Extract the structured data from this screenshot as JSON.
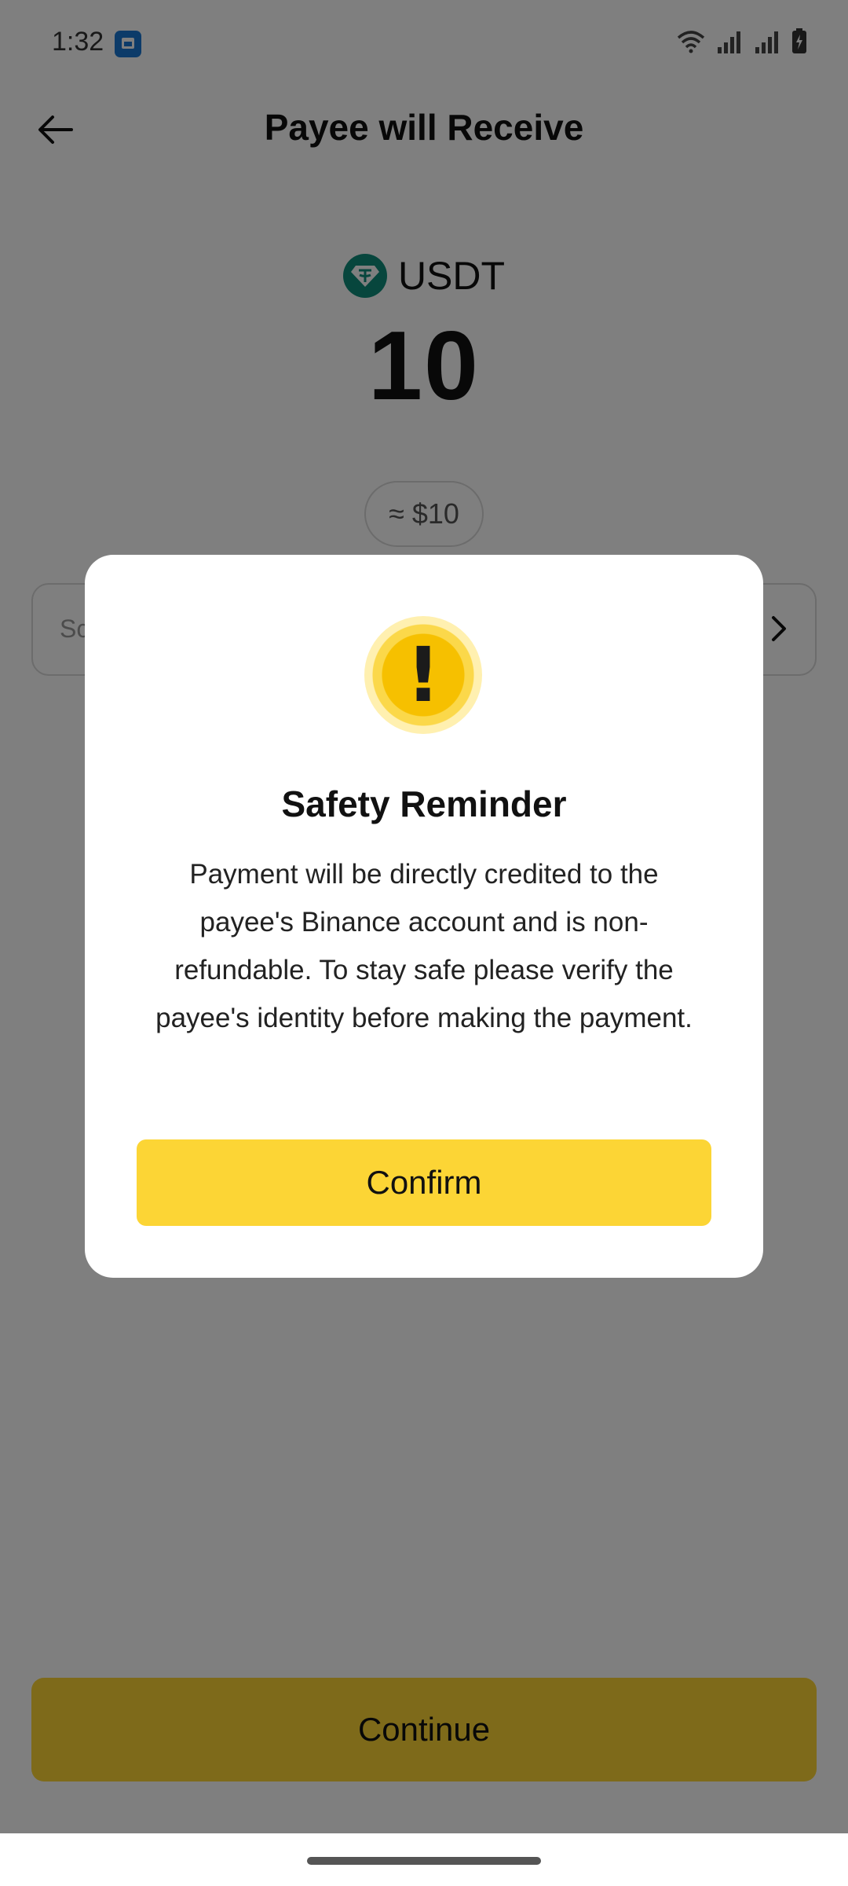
{
  "status_bar": {
    "time": "1:32",
    "icons": [
      "wifi-icon",
      "signal-icon",
      "signal-icon",
      "battery-charging-icon"
    ]
  },
  "header": {
    "title": "Payee will Receive",
    "back_icon": "arrow-left-icon"
  },
  "amount": {
    "currency": "USDT",
    "value": "10",
    "fiat_equivalent": "≈ $10",
    "coin_color": "#0e8c7a"
  },
  "note_field": {
    "placeholder": "Sc"
  },
  "footer": {
    "continue_label": "Continue"
  },
  "modal": {
    "icon": "warning-exclamation-icon",
    "icon_glyph": "!",
    "title": "Safety Reminder",
    "body": "Payment will be directly credited to the payee's Binance account and is non-refundable. To stay safe please verify the payee's identity before making the payment.",
    "confirm_label": "Confirm"
  },
  "colors": {
    "accent": "#fcd535",
    "overlay": "rgba(0,0,0,0.5)"
  }
}
